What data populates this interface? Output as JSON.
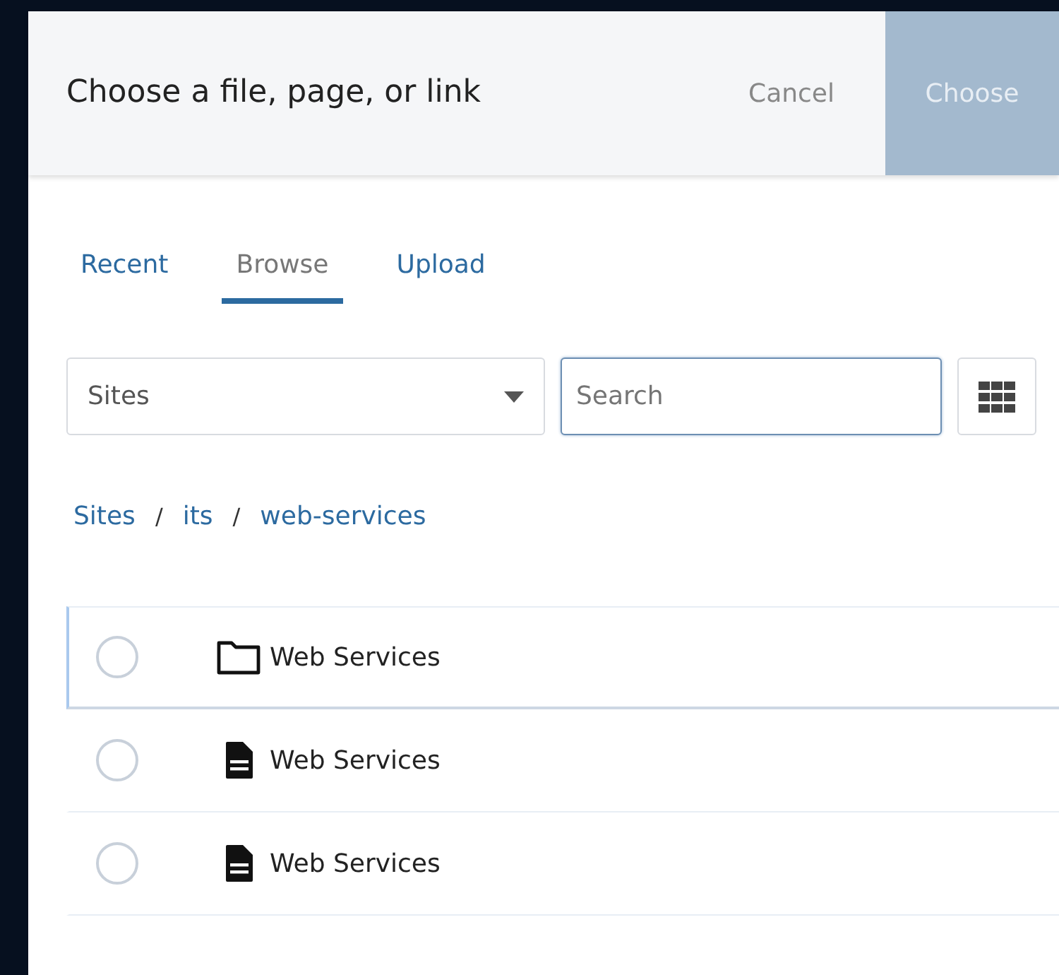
{
  "dialog": {
    "title": "Choose a file, page, or link",
    "buttons": [
      {
        "label": "Cancel",
        "kind": "secondary",
        "disabled": false
      },
      {
        "label": "Choose",
        "kind": "primary",
        "disabled": true
      }
    ]
  },
  "tabs": [
    {
      "label": "Recent",
      "selected": false
    },
    {
      "label": "Browse",
      "selected": true
    },
    {
      "label": "Upload",
      "selected": false
    }
  ],
  "source_select": {
    "value": "Sites"
  },
  "search": {
    "placeholder": "Search",
    "focused": true
  },
  "breadcrumb": {
    "separator": "/",
    "items": [
      "Sites",
      "its",
      "web-services"
    ]
  },
  "items": [
    {
      "name": "Web Services",
      "kind": "folder",
      "selected": false,
      "highlighted": true
    },
    {
      "name": "Web Services",
      "kind": "page",
      "selected": false,
      "highlighted": false
    },
    {
      "name": "Web Services",
      "kind": "page",
      "selected": false,
      "highlighted": false
    }
  ]
}
